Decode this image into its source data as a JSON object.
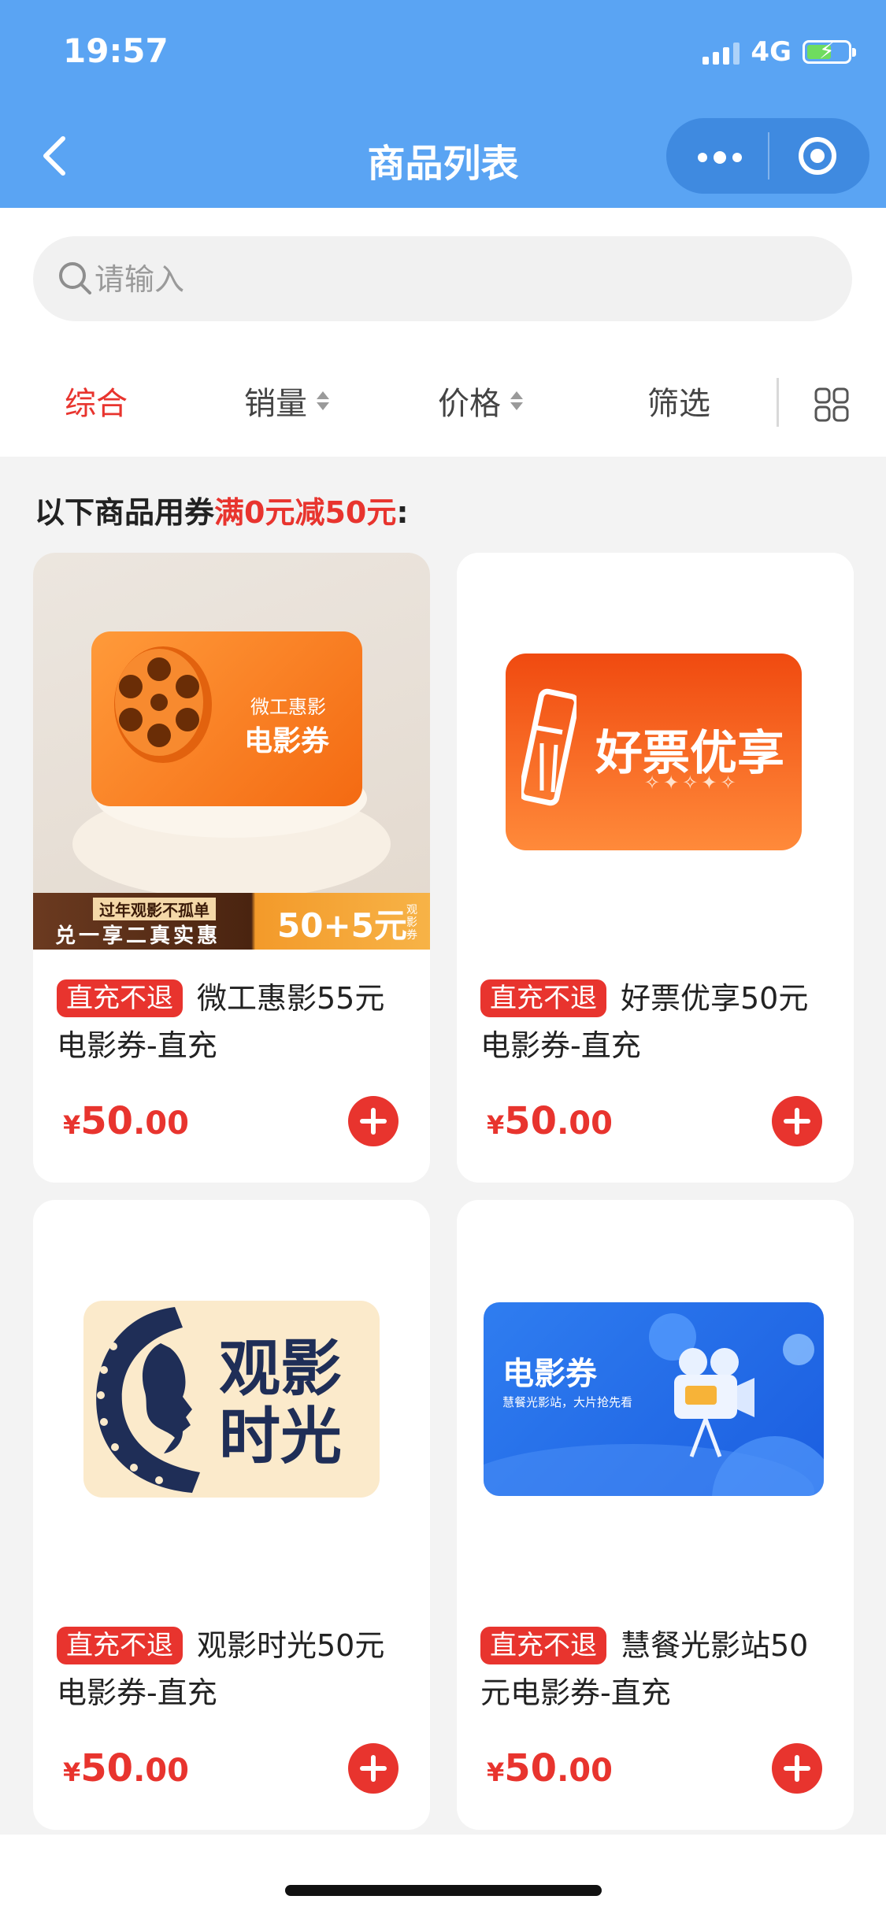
{
  "status": {
    "time": "19:57",
    "network": "4G"
  },
  "header": {
    "title": "商品列表"
  },
  "search": {
    "placeholder": "请输入"
  },
  "filters": [
    {
      "label": "综合",
      "active": true
    },
    {
      "label": "销量"
    },
    {
      "label": "价格"
    },
    {
      "label": "筛选"
    }
  ],
  "promo": {
    "prefix": "以下商品用券",
    "highlight": "满0元减50元",
    "suffix": ":"
  },
  "products": [
    {
      "badge": "直充不退",
      "name": "微工惠影55元电影券-直充",
      "currency": "¥",
      "price_int": "50",
      "price_dec": ".00",
      "image_texts": {
        "brand": "微工惠影",
        "ticket": "电影券",
        "slogan": "过年观影不孤单",
        "sub": "兑一享二真实惠",
        "offer": "50+5元",
        "offer_tag": "观影券"
      }
    },
    {
      "badge": "直充不退",
      "name": "好票优享50元电影券-直充",
      "currency": "¥",
      "price_int": "50",
      "price_dec": ".00",
      "image_texts": {
        "title": "好票优享"
      }
    },
    {
      "badge": "直充不退",
      "name": "观影时光50元电影券-直充",
      "currency": "¥",
      "price_int": "50",
      "price_dec": ".00",
      "image_texts": {
        "line1": "观影",
        "line2": "时光"
      }
    },
    {
      "badge": "直充不退",
      "name": "慧餐光影站50元电影券-直充",
      "currency": "¥",
      "price_int": "50",
      "price_dec": ".00",
      "image_texts": {
        "title": "电影券",
        "sub": "慧餐光影站，大片抢先看"
      }
    }
  ],
  "colors": {
    "header": "#5aa4f3",
    "accent": "#e8342e",
    "background": "#f3f3f3"
  }
}
